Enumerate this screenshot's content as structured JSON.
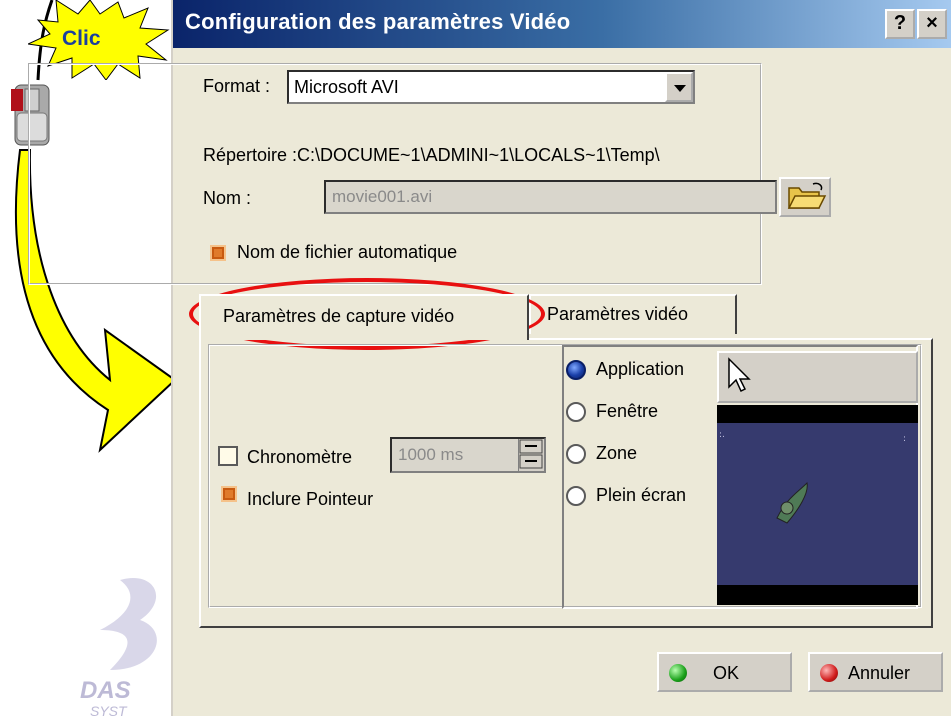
{
  "callout": {
    "text": "Clic"
  },
  "dialog": {
    "title": "Configuration des paramètres Vidéo",
    "help_label": "?",
    "close_label": "×",
    "format_label": "Format :",
    "format_value": "Microsoft AVI",
    "directory_label": "Répertoire :C:\\DOCUME~1\\ADMINI~1\\LOCALS~1\\Temp\\",
    "name_label": "Nom :",
    "name_value": "movie001.avi",
    "auto_name_label": "Nom de fichier automatique",
    "auto_name_checked": true,
    "tabs": [
      {
        "label": "Paramètres de capture vidéo",
        "active": true
      },
      {
        "label": "Paramètres vidéo",
        "active": false
      }
    ],
    "capture": {
      "chrono_label": "Chronomètre",
      "chrono_checked": false,
      "chrono_value": "1000 ms",
      "include_pointer_label": "Inclure Pointeur",
      "include_pointer_checked": true,
      "modes": [
        {
          "label": "Application",
          "selected": true
        },
        {
          "label": "Fenêtre",
          "selected": false
        },
        {
          "label": "Zone",
          "selected": false
        },
        {
          "label": "Plein écran",
          "selected": false
        }
      ]
    },
    "ok_label": "OK",
    "cancel_label": "Annuler"
  },
  "colors": {
    "title_gradient_start": "#0a246a",
    "dialog_bg": "#ece9d8",
    "highlight_ellipse": "#e81010",
    "callout_fill": "#ffff00",
    "preview_bg": "#363a6e"
  },
  "icons": {
    "tool": "video-record-icon",
    "folder": "folder-open-icon",
    "pointer": "cursor-arrow-icon",
    "ok": "green-dot-icon",
    "cancel": "red-dot-icon"
  }
}
